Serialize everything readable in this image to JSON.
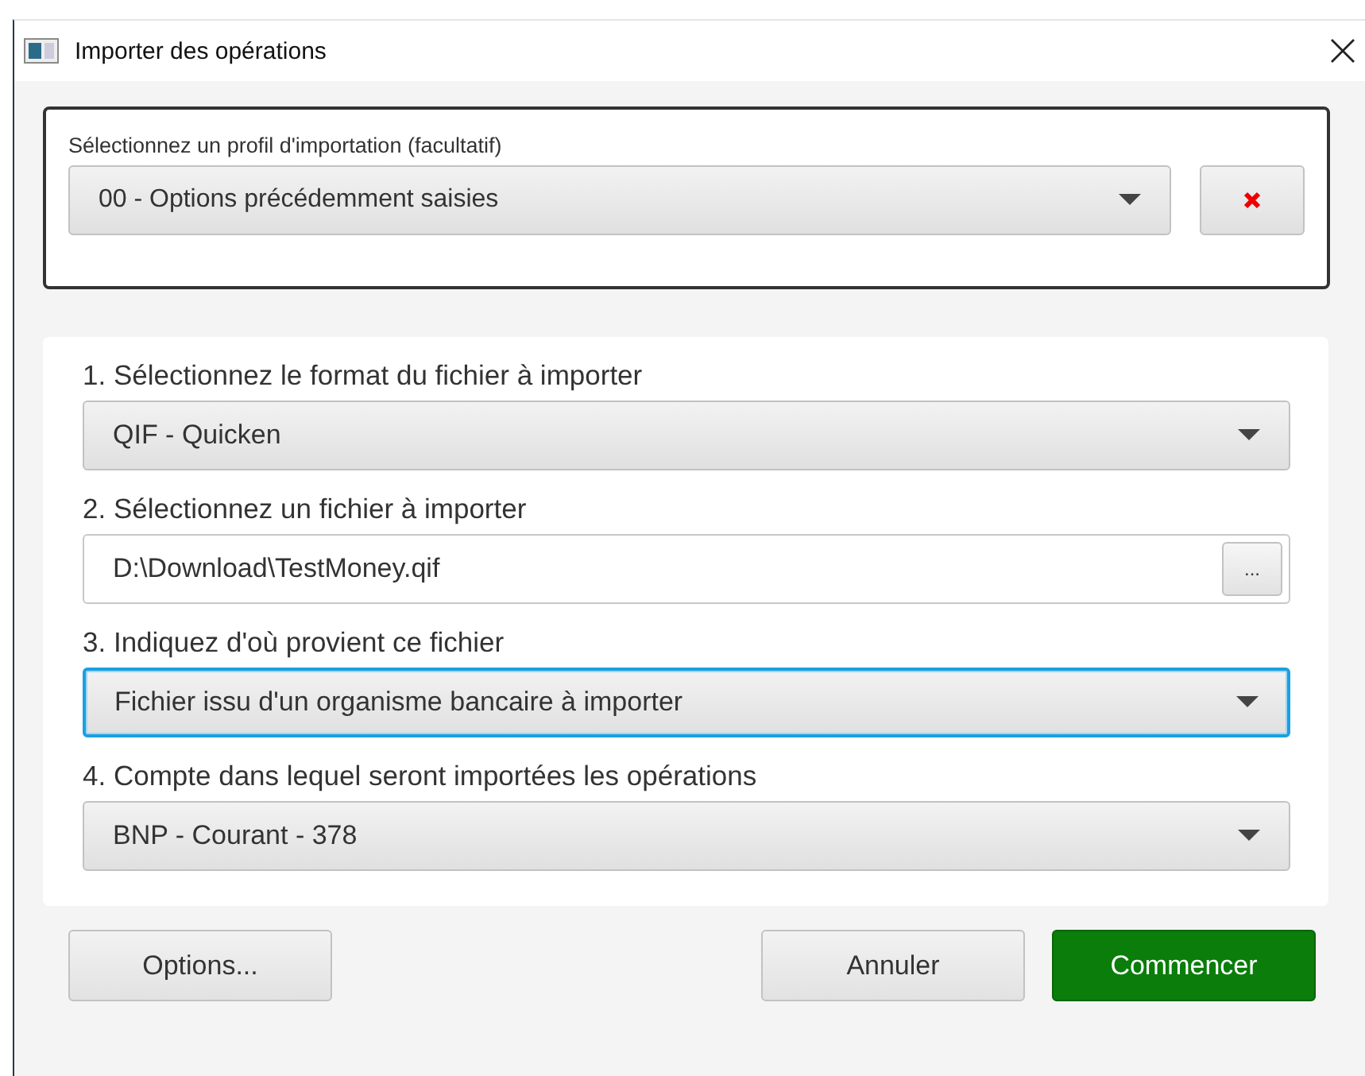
{
  "window": {
    "title": "Importer des opérations"
  },
  "profile": {
    "label": "Sélectionnez un profil d'importation (facultatif)",
    "value": "00 - Options précédemment saisies"
  },
  "steps": [
    {
      "kind": "combo",
      "label": "1. Sélectionnez le format du fichier à importer",
      "value": "QIF - Quicken",
      "focused": false
    },
    {
      "kind": "file",
      "label": "2. Sélectionnez un fichier à importer",
      "value": "D:\\Download\\TestMoney.qif",
      "browse": "...",
      "focused": false
    },
    {
      "kind": "combo",
      "label": "3. Indiquez d'où provient ce fichier",
      "value": "Fichier issu d'un organisme bancaire à importer",
      "focused": true
    },
    {
      "kind": "combo",
      "label": "4. Compte dans lequel seront importées les opérations",
      "value": "BNP - Courant - 378",
      "focused": false
    }
  ],
  "buttons": [
    {
      "kind": "default",
      "label": "Options..."
    },
    {
      "kind": "default",
      "label": "Annuler"
    },
    {
      "kind": "primary",
      "label": "Commencer"
    }
  ]
}
